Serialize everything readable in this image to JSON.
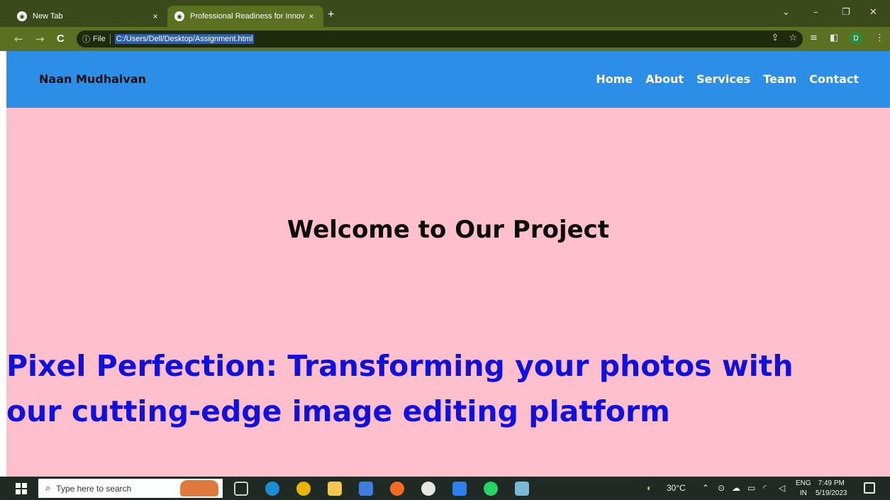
{
  "browser": {
    "tabs": [
      {
        "label": "New Tab",
        "active": false
      },
      {
        "label": "Professional Readiness for Innov",
        "active": true
      }
    ],
    "new_tab_symbol": "+",
    "close_symbol": "×",
    "nav": {
      "back": "←",
      "forward": "→",
      "reload": "C"
    },
    "omnibox": {
      "info_label": "File",
      "url": "C:/Users/Dell/Desktop/Assignment.html"
    },
    "profile_initial": "D",
    "icons": [
      "share-icon",
      "star-icon",
      "reading-list-icon",
      "side-panel-icon",
      "menu-icon"
    ]
  },
  "site": {
    "brand": "Naan Mudhalvan",
    "nav_links": [
      "Home",
      "About",
      "Services",
      "Team",
      "Contact"
    ],
    "heading": "Welcome to Our Project",
    "tagline": "Pixel Perfection: Transforming your photos with our cutting-edge image editing platform",
    "colors": {
      "navbar": "#2d8ee8",
      "background": "#ffc0cb",
      "tagline": "#1010e0"
    }
  },
  "taskbar": {
    "search_placeholder": "Type here to search",
    "weather": "30°C",
    "lang_top": "ENG",
    "lang_bottom": "IN",
    "time": "7:49 PM",
    "date": "5/19/2023"
  }
}
